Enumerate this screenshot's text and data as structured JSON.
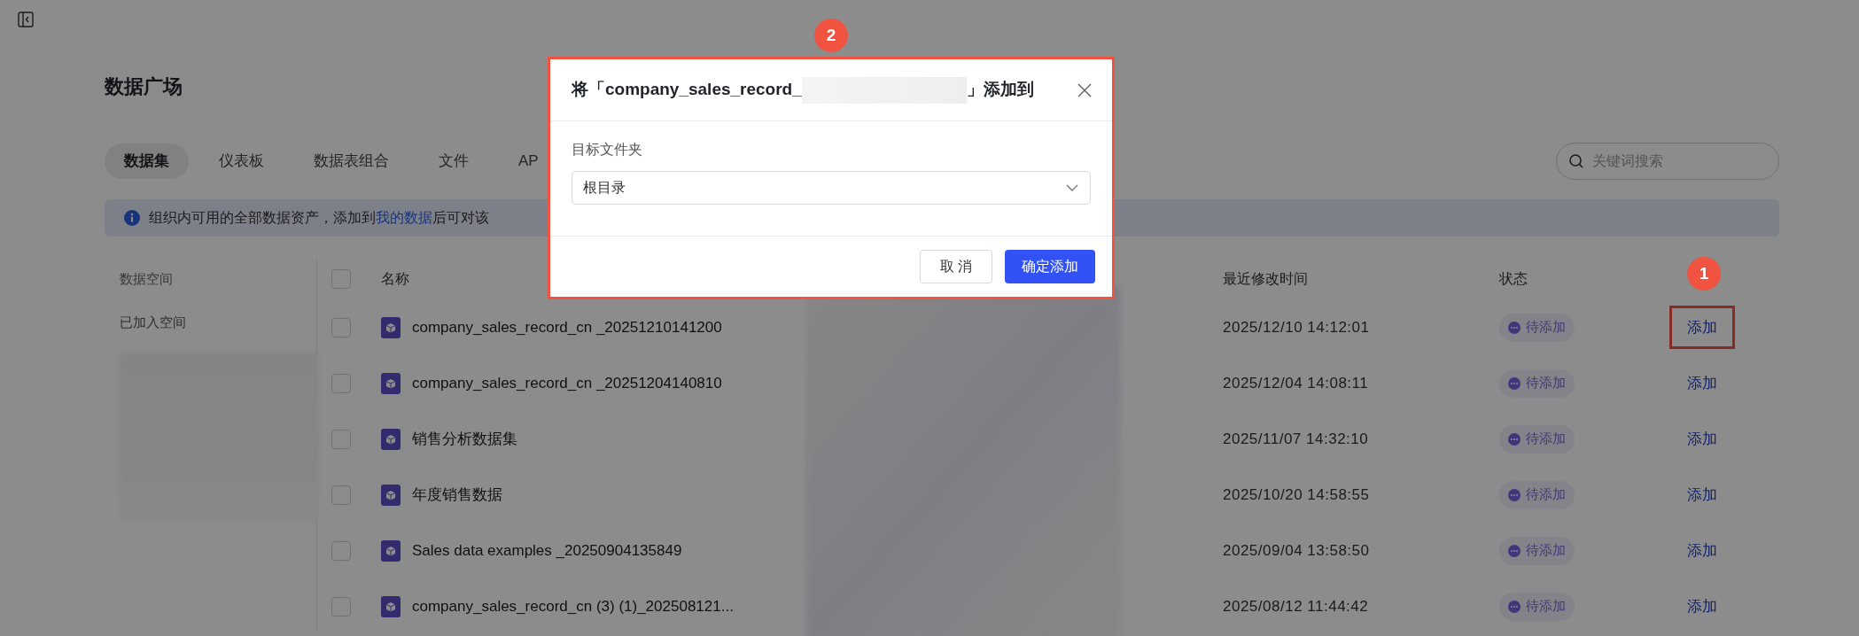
{
  "page_title": "数据广场",
  "tabs": [
    {
      "label": "数据集",
      "selected": true
    },
    {
      "label": "仪表板",
      "selected": false
    },
    {
      "label": "数据表组合",
      "selected": false
    },
    {
      "label": "文件",
      "selected": false
    },
    {
      "label": "AP",
      "selected": false
    }
  ],
  "search": {
    "placeholder": "关键词搜索"
  },
  "notice": {
    "before": "组织内可用的全部数据资产，添加到",
    "link": "我的数据",
    "after": "后可对该"
  },
  "filters": [
    {
      "label": "数据空间",
      "kind": "heading"
    },
    {
      "label": "已加入空间",
      "kind": "item"
    }
  ],
  "table": {
    "select_all_checked": false,
    "columns": [
      "名称",
      "最近修改时间",
      "状态"
    ],
    "rows": [
      {
        "name": "company_sales_record_cn _20251210141200",
        "modified": "2025/12/10 14:12:01",
        "status": "待添加",
        "action": "添加",
        "highlighted": true,
        "callout": "1",
        "checked": false
      },
      {
        "name": "company_sales_record_cn _20251204140810",
        "modified": "2025/12/04 14:08:11",
        "status": "待添加",
        "action": "添加",
        "highlighted": false,
        "checked": false
      },
      {
        "name": "销售分析数据集",
        "modified": "2025/11/07 14:32:10",
        "status": "待添加",
        "action": "添加",
        "highlighted": false,
        "checked": false
      },
      {
        "name": "年度销售数据",
        "modified": "2025/10/20 14:58:55",
        "status": "待添加",
        "action": "添加",
        "highlighted": false,
        "checked": false
      },
      {
        "name": "Sales data examples _20250904135849",
        "modified": "2025/09/04 13:58:50",
        "status": "待添加",
        "action": "添加",
        "highlighted": false,
        "checked": false
      },
      {
        "name": "company_sales_record_cn (3) (1)_202508121...",
        "modified": "2025/08/12 11:44:42",
        "status": "待添加",
        "action": "添加",
        "highlighted": false,
        "checked": false
      }
    ]
  },
  "dialog": {
    "callout": "2",
    "title_before": "将「company_sales_record_",
    "title_after": "」添加到",
    "field_label": "目标文件夹",
    "value": "根目录",
    "buttons": [
      {
        "label": "取 消",
        "kind": "secondary"
      },
      {
        "label": "确定添加",
        "kind": "primary"
      }
    ]
  }
}
